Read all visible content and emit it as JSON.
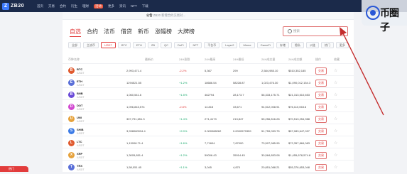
{
  "nav": {
    "logo_text": "ZB20",
    "links": [
      "首页",
      "交易",
      "合约",
      "衍生",
      "理财",
      "活动",
      "更多",
      "资讯",
      "NFT",
      "下载"
    ]
  },
  "subbar": {
    "crumb_pre": "公告",
    "crumb_text": "ZB20 新增合约交易对…"
  },
  "tabs": [
    {
      "label": "自选",
      "active": true
    },
    {
      "label": "合约",
      "active": false
    },
    {
      "label": "法币",
      "active": false
    },
    {
      "label": "借贷",
      "active": false
    },
    {
      "label": "新币",
      "active": false
    },
    {
      "label": "涨幅榜",
      "active": false
    },
    {
      "label": "大牌榜",
      "active": false
    }
  ],
  "search": {
    "placeholder": "搜索"
  },
  "chips": [
    "全部",
    "主流币",
    "USDT",
    "BTC",
    "ETH",
    "ZB",
    "QC",
    "DeFi",
    "NFT",
    "平台币",
    "Layer2",
    "Meme",
    "GameFi",
    "存储",
    "隐私",
    "公链",
    "热门",
    "更多"
  ],
  "chip_active_index": 2,
  "columns": [
    "币种名称",
    "最新价",
    "24H涨跌",
    "24H最高",
    "24H最低",
    "24H成交量",
    "24H成交额",
    "操作",
    "收藏"
  ],
  "rows": [
    {
      "sym": "BTC",
      "sub": "/USDT",
      "price": "2,993,471.4",
      "chg": "-2.2%",
      "dir": "down",
      "high": "5,367",
      "low": "299",
      "vol": "2,584,985.10",
      "amount": "$510,352,185",
      "color": "#e05a2f",
      "icon": "B"
    },
    {
      "sym": "ETH",
      "sub": "/USDT",
      "price": "1294521.55",
      "chg": "+1.2%",
      "dir": "up",
      "high": "18686.54",
      "low": "58228.87",
      "vol": "1,023,476.30",
      "amount": "$1,090,012,154.3",
      "color": "#5a6fd8",
      "icon": "E"
    },
    {
      "sym": "BNB",
      "sub": "/USDT",
      "price": "1,060,541.6",
      "chg": "+1.5%",
      "dir": "up",
      "high": "462794",
      "low": "28,173.7",
      "vol": "56,333,175.71",
      "amount": "$21,313,510,653",
      "color": "#6b4bd8",
      "icon": "B"
    },
    {
      "sym": "DOT",
      "sub": "/USDT",
      "price": "1,096,843,574",
      "chg": "-2.8%",
      "dir": "down",
      "high": "14.815",
      "low": "33,671",
      "vol": "94,512,008.91",
      "amount": "$76,110,063.6",
      "color": "#d24ad1",
      "icon": "D"
    },
    {
      "sym": "UNI",
      "sub": "/USDT",
      "price": "307,791,651.3",
      "chg": "+1.4%",
      "dir": "up",
      "high": "271,4173",
      "low": "213,847",
      "vol": "55,256,816.28",
      "amount": "$70,513,254,988",
      "color": "#e6a23c",
      "icon": "U"
    },
    {
      "sym": "SHIB",
      "sub": "/USDT",
      "price": "3,938080934.4",
      "chg": "+2.0%",
      "dir": "up",
      "high": "0.000088262",
      "low": "0.0000579359",
      "vol": "51,759,053.75",
      "amount": "$57,083,647,097",
      "color": "#3c7be6",
      "icon": "S"
    },
    {
      "sym": "LTC",
      "sub": "/USDT",
      "price": "1,13008.71.4",
      "chg": "+1.6%",
      "dir": "up",
      "high": "7,71604",
      "low": "7,87000",
      "vol": "73,507,985.95",
      "amount": "$72,357,884,083",
      "color": "#e05a2f",
      "icon": "L"
    },
    {
      "sym": "XRP",
      "sub": "/USDT",
      "price": "1,3005,851.4",
      "chg": "+1.2%",
      "dir": "up",
      "high": "59006.43",
      "low": "35014.45",
      "vol": "30,584,853.08",
      "amount": "$1,455,678,574.8",
      "color": "#e6a23c",
      "icon": "X"
    },
    {
      "sym": "TRX",
      "sub": "/USDT",
      "price": "1,58,051.45",
      "chg": "+1.1%",
      "dir": "up",
      "high": "3,045",
      "low": "4,870",
      "vol": "20,851,088.21",
      "amount": "$55,376,653,048",
      "color": "#5a6fd8",
      "icon": "T"
    }
  ],
  "trade_label": "交易",
  "badge": "热门",
  "watermark": "币圈子",
  "colors": {
    "accent": "#e23c3c",
    "nav_bg": "#1b2a4a",
    "up": "#16a86b",
    "down": "#e23c3c"
  }
}
